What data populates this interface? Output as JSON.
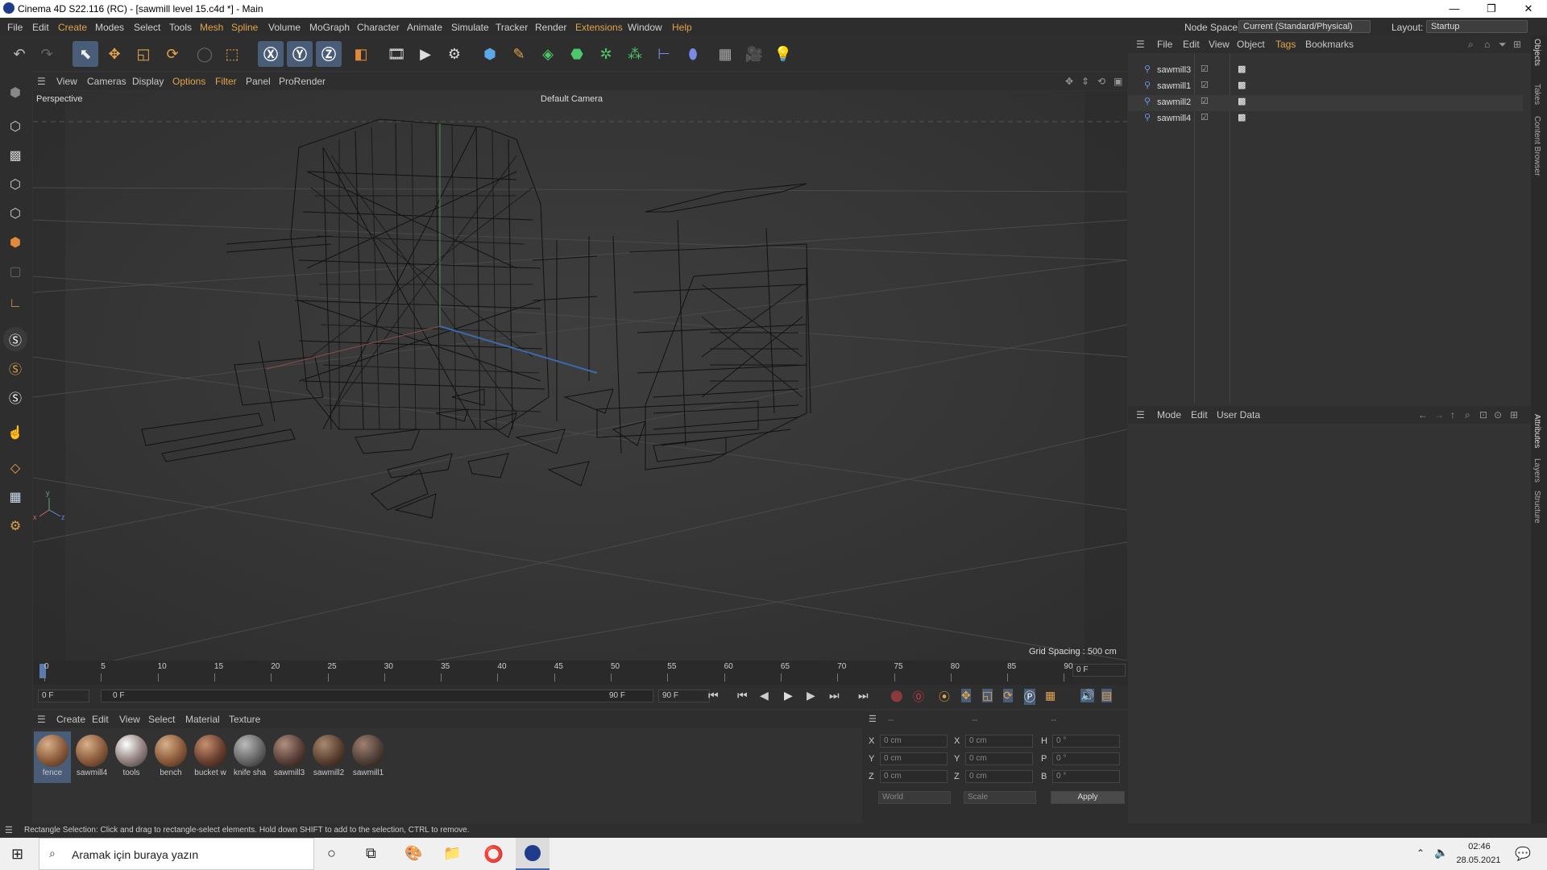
{
  "window": {
    "title": "Cinema 4D S22.116 (RC) - [sawmill level 15.c4d *] - Main",
    "min": "—",
    "max": "❐",
    "close": "✕"
  },
  "menu": [
    "File",
    "Edit",
    "Create",
    "Modes",
    "Select",
    "Tools",
    "Mesh",
    "Spline",
    "Volume",
    "MoGraph",
    "Character",
    "Animate",
    "Simulate",
    "Tracker",
    "Render",
    "Extensions",
    "Window",
    "Help"
  ],
  "nodespace": {
    "label": "Node Space:",
    "value": "Current (Standard/Physical)"
  },
  "layout": {
    "label": "Layout:",
    "value": "Startup"
  },
  "viewport": {
    "menu": [
      "View",
      "Cameras",
      "Display",
      "Options",
      "Filter",
      "Panel",
      "ProRender"
    ],
    "name": "Perspective",
    "camera": "Default Camera",
    "grid": "Grid Spacing : 500 cm"
  },
  "timeline": {
    "ticks": [
      "0",
      "5",
      "10",
      "15",
      "20",
      "25",
      "30",
      "35",
      "40",
      "45",
      "50",
      "55",
      "60",
      "65",
      "70",
      "75",
      "80",
      "85",
      "90"
    ],
    "current": "0 F",
    "start": "0 F",
    "range_start": "0 F",
    "range_end": "90 F",
    "end": "90 F"
  },
  "materials": {
    "menu": [
      "Create",
      "Edit",
      "View",
      "Select",
      "Material",
      "Texture"
    ],
    "items": [
      "fence",
      "sawmill4",
      "tools",
      "bench",
      "bucket w",
      "knife sha",
      "sawmill3",
      "sawmill2",
      "sawmill1"
    ]
  },
  "coords": {
    "headers": [
      "--",
      "--",
      "--"
    ],
    "rows": [
      {
        "a": "X",
        "av": "0 cm",
        "b": "X",
        "bv": "0 cm",
        "c": "H",
        "cv": "0 °"
      },
      {
        "a": "Y",
        "av": "0 cm",
        "b": "Y",
        "bv": "0 cm",
        "c": "P",
        "cv": "0 °"
      },
      {
        "a": "Z",
        "av": "0 cm",
        "b": "Z",
        "bv": "0 cm",
        "c": "B",
        "cv": "0 °"
      }
    ],
    "world": "World",
    "scale": "Scale",
    "apply": "Apply"
  },
  "objects": {
    "menu": [
      "File",
      "Edit",
      "View",
      "Object",
      "Tags",
      "Bookmarks"
    ],
    "items": [
      "sawmill3",
      "sawmill1",
      "sawmill2",
      "sawmill4"
    ]
  },
  "attributes": {
    "menu": [
      "Mode",
      "Edit",
      "User Data"
    ]
  },
  "side_tabs": {
    "top": [
      "Objects",
      "Takes",
      "Content Browser"
    ],
    "bottom": [
      "Attributes",
      "Layers",
      "Structure"
    ]
  },
  "status": "Rectangle Selection: Click and drag to rectangle-select elements. Hold down SHIFT to add to the selection, CTRL to remove.",
  "taskbar": {
    "search": "Aramak için buraya yazın",
    "time": "02:46",
    "date": "28.05.2021"
  }
}
